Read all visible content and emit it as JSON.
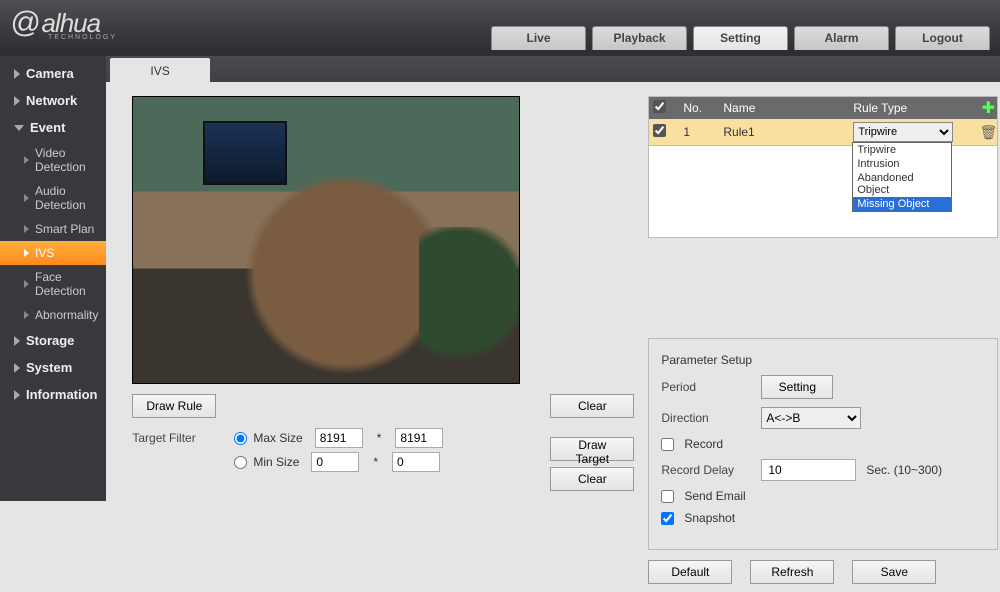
{
  "logo": {
    "text": "alhua",
    "caption": "TECHNOLOGY"
  },
  "tabs": {
    "live": "Live",
    "playback": "Playback",
    "setting": "Setting",
    "alarm": "Alarm",
    "logout": "Logout"
  },
  "sidebar": {
    "camera": "Camera",
    "network": "Network",
    "event": "Event",
    "event_items": {
      "video_detection": "Video Detection",
      "audio_detection": "Audio Detection",
      "smart_plan": "Smart Plan",
      "ivs": "IVS",
      "face_detection": "Face Detection",
      "abnormality": "Abnormality"
    },
    "storage": "Storage",
    "system": "System",
    "information": "Information"
  },
  "content_tab": "IVS",
  "buttons": {
    "draw_rule": "Draw Rule",
    "clear": "Clear",
    "draw_target": "Draw Target",
    "default": "Default",
    "refresh": "Refresh",
    "save": "Save",
    "setting": "Setting"
  },
  "target_filter": {
    "label": "Target Filter",
    "max": "Max Size",
    "min": "Min Size",
    "max_w": "8191",
    "max_h": "8191",
    "min_w": "0",
    "min_h": "0"
  },
  "table": {
    "cols": {
      "no": "No.",
      "name": "Name",
      "ruletype": "Rule Type"
    },
    "row1": {
      "no": "1",
      "name": "Rule1",
      "type": "Tripwire"
    },
    "options": {
      "tripwire": "Tripwire",
      "intrusion": "Intrusion",
      "abandoned": "Abandoned Object",
      "missing": "Missing Object"
    }
  },
  "param": {
    "legend": "Parameter Setup",
    "period": "Period",
    "direction": "Direction",
    "direction_val": "A<->B",
    "record": "Record",
    "record_delay": "Record Delay",
    "record_delay_val": "10",
    "record_delay_unit": "Sec. (10~300)",
    "send_email": "Send Email",
    "snapshot": "Snapshot"
  }
}
